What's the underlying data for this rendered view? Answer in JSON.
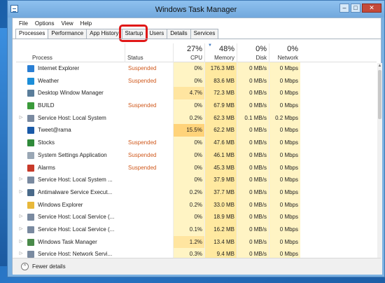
{
  "window": {
    "title": "Windows Task Manager"
  },
  "controls": {
    "minimize": "–",
    "maximize": "□",
    "close": "✕"
  },
  "menu": [
    "File",
    "Options",
    "View",
    "Help"
  ],
  "tabs": [
    "Processes",
    "Performance",
    "App History",
    "Startup",
    "Users",
    "Details",
    "Services"
  ],
  "columns": {
    "process": "Process",
    "status": "Status",
    "cpu": {
      "pct": "27%",
      "label": "CPU"
    },
    "memory": {
      "pct": "48%",
      "label": "Memory"
    },
    "disk": {
      "pct": "0%",
      "label": "Disk"
    },
    "network": {
      "pct": "0%",
      "label": "Network"
    }
  },
  "rows": [
    {
      "expand": "",
      "icon": "internet-explorer-icon",
      "color": "#2a7fd4",
      "name": "Internet Explorer",
      "status": "Suspended",
      "cpu": "0%",
      "mem": "176.3 MB",
      "disk": "0 MB/s",
      "net": "0 Mbps"
    },
    {
      "expand": "",
      "icon": "weather-icon",
      "color": "#1c8ed8",
      "name": "Weather",
      "status": "Suspended",
      "cpu": "0%",
      "mem": "83.6 MB",
      "disk": "0 MB/s",
      "net": "0 Mbps"
    },
    {
      "expand": "",
      "icon": "desktop-window-manager-icon",
      "color": "#5a7d9a",
      "name": "Desktop Window Manager",
      "status": "",
      "cpu": "4.7%",
      "mem": "72.3 MB",
      "disk": "0 MB/s",
      "net": "0 Mbps"
    },
    {
      "expand": "",
      "icon": "build-icon",
      "color": "#3a9a3a",
      "name": "BUILD",
      "status": "Suspended",
      "cpu": "0%",
      "mem": "67.9 MB",
      "disk": "0 MB/s",
      "net": "0 Mbps"
    },
    {
      "expand": "▷",
      "icon": "service-host-icon",
      "color": "#7a8aa0",
      "name": "Service Host: Local System",
      "status": "",
      "cpu": "0.2%",
      "mem": "62.3 MB",
      "disk": "0.1 MB/s",
      "net": "0.2 Mbps"
    },
    {
      "expand": "",
      "icon": "tweetarama-icon",
      "color": "#1a5aa8",
      "name": "Tweet@rama",
      "status": "",
      "cpu": "15.5%",
      "mem": "62.2 MB",
      "disk": "0 MB/s",
      "net": "0 Mbps"
    },
    {
      "expand": "",
      "icon": "stocks-icon",
      "color": "#2f8a3a",
      "name": "Stocks",
      "status": "Suspended",
      "cpu": "0%",
      "mem": "47.6 MB",
      "disk": "0 MB/s",
      "net": "0 Mbps"
    },
    {
      "expand": "",
      "icon": "system-settings-icon",
      "color": "#9aa7b5",
      "name": "System Settings Application",
      "status": "Suspended",
      "cpu": "0%",
      "mem": "46.1 MB",
      "disk": "0 MB/s",
      "net": "0 Mbps"
    },
    {
      "expand": "",
      "icon": "alarms-icon",
      "color": "#c83a2a",
      "name": "Alarms",
      "status": "Suspended",
      "cpu": "0%",
      "mem": "45.3 MB",
      "disk": "0 MB/s",
      "net": "0 Mbps"
    },
    {
      "expand": "▷",
      "icon": "service-host-icon",
      "color": "#7a8aa0",
      "name": "Service Host: Local System ...",
      "status": "",
      "cpu": "0%",
      "mem": "37.9 MB",
      "disk": "0 MB/s",
      "net": "0 Mbps"
    },
    {
      "expand": "▷",
      "icon": "antimalware-icon",
      "color": "#4a6a8a",
      "name": "Antimalware Service Execut...",
      "status": "",
      "cpu": "0.2%",
      "mem": "37.7 MB",
      "disk": "0 MB/s",
      "net": "0 Mbps"
    },
    {
      "expand": "",
      "icon": "windows-explorer-icon",
      "color": "#e8b83a",
      "name": "Windows Explorer",
      "status": "",
      "cpu": "0.2%",
      "mem": "33.0 MB",
      "disk": "0 MB/s",
      "net": "0 Mbps"
    },
    {
      "expand": "▷",
      "icon": "service-host-icon",
      "color": "#7a8aa0",
      "name": "Service Host: Local Service (...",
      "status": "",
      "cpu": "0%",
      "mem": "18.9 MB",
      "disk": "0 MB/s",
      "net": "0 Mbps"
    },
    {
      "expand": "▷",
      "icon": "service-host-icon",
      "color": "#7a8aa0",
      "name": "Service Host: Local Service (...",
      "status": "",
      "cpu": "0.1%",
      "mem": "16.2 MB",
      "disk": "0 MB/s",
      "net": "0 Mbps"
    },
    {
      "expand": "▷",
      "icon": "task-manager-icon",
      "color": "#4a8a4a",
      "name": "Windows Task Manager",
      "status": "",
      "cpu": "1.2%",
      "mem": "13.4 MB",
      "disk": "0 MB/s",
      "net": "0 Mbps"
    },
    {
      "expand": "▷",
      "icon": "service-host-icon",
      "color": "#7a8aa0",
      "name": "Service Host: Network Servi...",
      "status": "",
      "cpu": "0.3%",
      "mem": "9.4 MB",
      "disk": "0 MB/s",
      "net": "0 Mbps"
    }
  ],
  "footer": {
    "fewer_details": "Fewer details"
  }
}
